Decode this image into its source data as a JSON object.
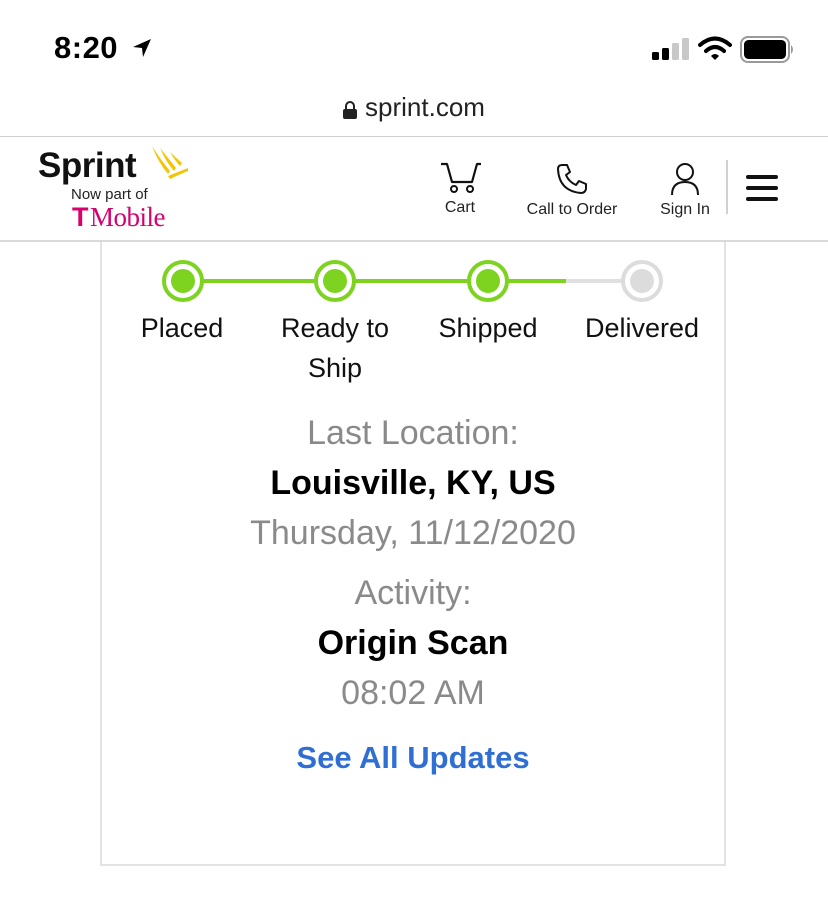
{
  "status_bar": {
    "time": "8:20",
    "icons": [
      "location-arrow-icon",
      "cellular-signal-icon",
      "wifi-icon",
      "battery-icon"
    ]
  },
  "browser": {
    "url": "sprint.com",
    "lock_icon": "lock-icon"
  },
  "header": {
    "brand": "Sprint",
    "tagline": "Now part of",
    "partner_t": "T",
    "partner_name": "Mobile",
    "nav": [
      {
        "label": "Cart",
        "icon": "cart-icon"
      },
      {
        "label": "Call to Order",
        "icon": "phone-icon"
      },
      {
        "label": "Sign In",
        "icon": "user-icon"
      }
    ],
    "menu_icon": "hamburger-menu-icon"
  },
  "tracking": {
    "steps": [
      {
        "label": "Placed",
        "status": "complete"
      },
      {
        "label": "Ready to Ship",
        "status": "complete"
      },
      {
        "label": "Shipped",
        "status": "complete"
      },
      {
        "label": "Delivered",
        "status": "pending"
      }
    ],
    "last_location_label": "Last Location:",
    "last_location": "Louisville, KY, US",
    "date": "Thursday, 11/12/2020",
    "activity_label": "Activity:",
    "activity": "Origin Scan",
    "time": "08:02 AM",
    "see_all": "See All Updates"
  },
  "colors": {
    "progress_complete": "#7ed321",
    "progress_pending": "#dcdcdc",
    "link": "#2f6fd4",
    "tmobile_magenta": "#d6006f",
    "sprint_yellow": "#f5c400"
  }
}
